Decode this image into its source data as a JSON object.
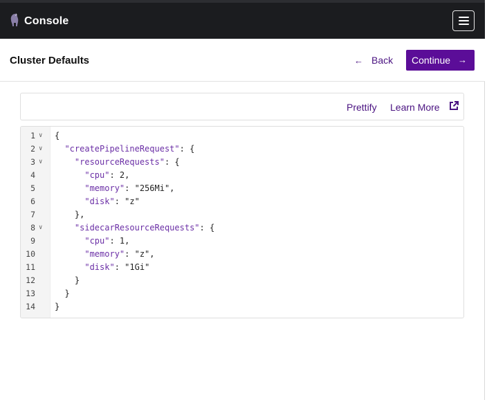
{
  "app": {
    "brand": "Console"
  },
  "header": {
    "title": "Cluster Defaults",
    "back_label": "Back",
    "continue_label": "Continue"
  },
  "toolbar": {
    "prettify_label": "Prettify",
    "learn_more_label": "Learn More"
  },
  "editor": {
    "lines": [
      {
        "num": "1",
        "fold": true,
        "text": "{"
      },
      {
        "num": "2",
        "fold": true,
        "text": "  \"createPipelineRequest\": {"
      },
      {
        "num": "3",
        "fold": true,
        "text": "    \"resourceRequests\": {"
      },
      {
        "num": "4",
        "fold": false,
        "text": "      \"cpu\": 2,"
      },
      {
        "num": "5",
        "fold": false,
        "text": "      \"memory\": \"256Mi\","
      },
      {
        "num": "6",
        "fold": false,
        "text": "      \"disk\": \"z\""
      },
      {
        "num": "7",
        "fold": false,
        "text": "    },"
      },
      {
        "num": "8",
        "fold": true,
        "text": "    \"sidecarResourceRequests\": {"
      },
      {
        "num": "9",
        "fold": false,
        "text": "      \"cpu\": 1,"
      },
      {
        "num": "10",
        "fold": false,
        "text": "      \"memory\": \"z\","
      },
      {
        "num": "11",
        "fold": false,
        "text": "      \"disk\": \"1Gi\""
      },
      {
        "num": "12",
        "fold": false,
        "text": "    }"
      },
      {
        "num": "13",
        "fold": false,
        "text": "  }"
      },
      {
        "num": "14",
        "fold": false,
        "text": "}"
      }
    ]
  },
  "icons": {
    "logo": "pachyderm-logo-icon",
    "menu": "hamburger-menu-icon",
    "back": "arrow-left-icon",
    "continue": "arrow-right-icon",
    "external": "external-link-icon",
    "fold": "chevron-down-icon"
  },
  "colors": {
    "topbar": "#1b1c1f",
    "accent": "#5b0d98",
    "link": "#4a1281",
    "json_key": "#6b2fa6"
  }
}
